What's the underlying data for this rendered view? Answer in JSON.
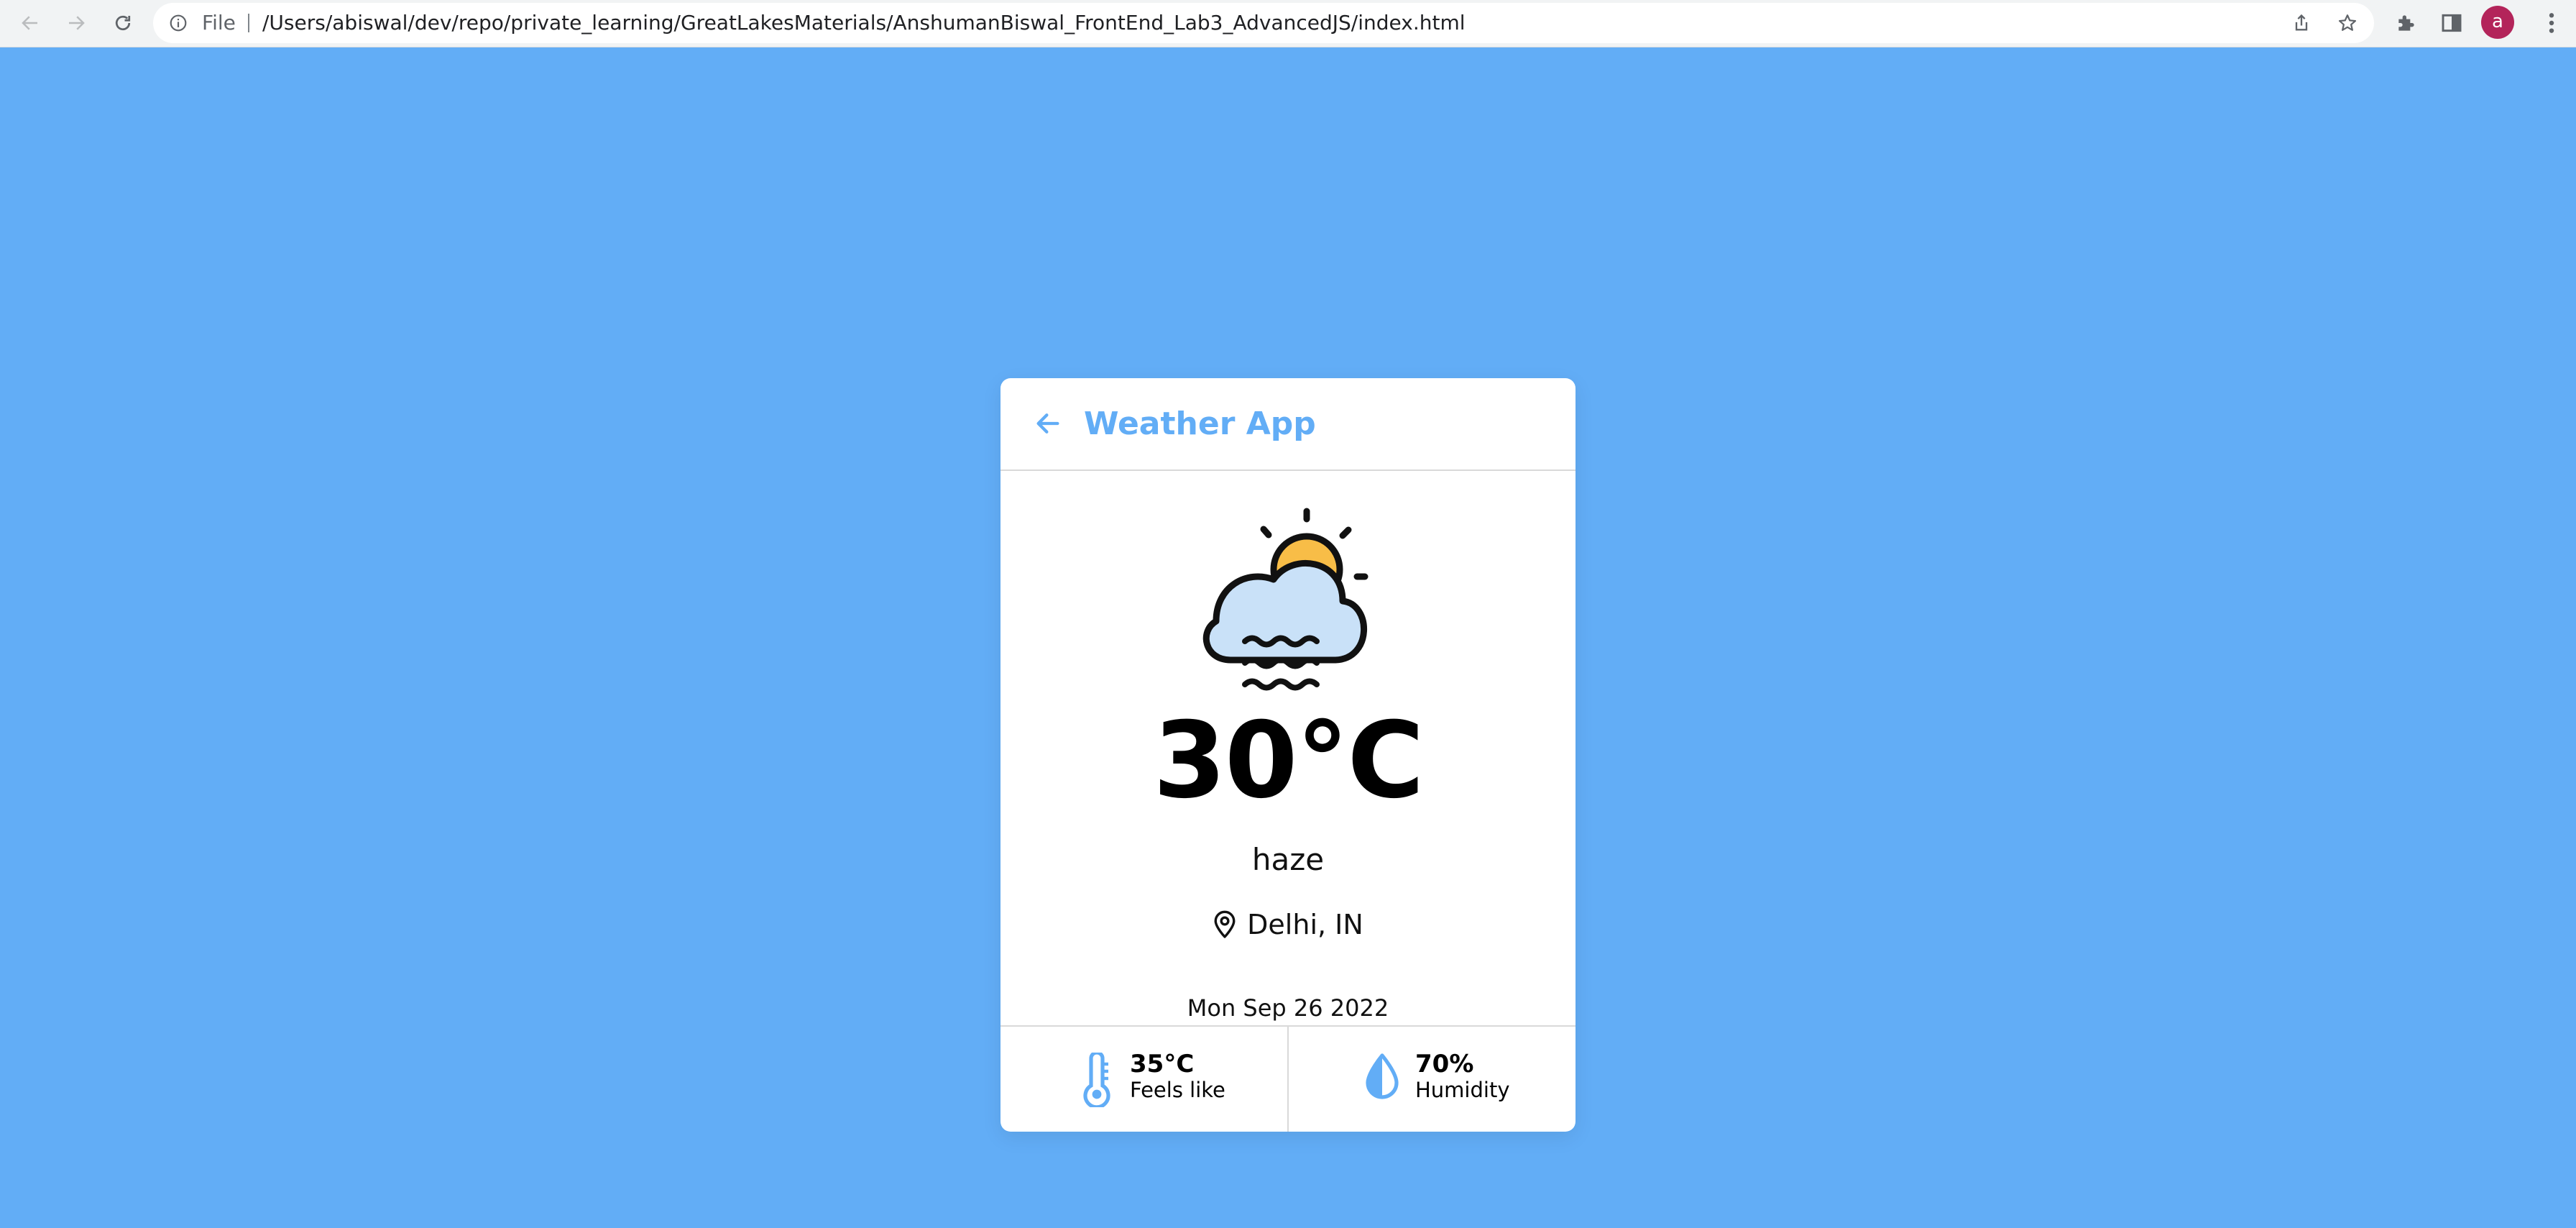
{
  "browser": {
    "scheme_label": "File",
    "url": "/Users/abiswal/dev/repo/private_learning/GreatLakesMaterials/AnshumanBiswal_FrontEnd_Lab3_AdvancedJS/index.html",
    "profile_initial": "a",
    "icons": [
      "back-arrow-icon",
      "forward-arrow-icon",
      "reload-icon",
      "info-icon",
      "share-icon",
      "star-icon",
      "puzzle-icon",
      "side-panel-icon",
      "kebab-menu-icon"
    ]
  },
  "colors": {
    "page_background": "#62adf6",
    "accent": "#62adf6",
    "sun": "#f8bd47",
    "cloud": "#c9e1f8",
    "avatar": "#b3245a"
  },
  "app": {
    "title": "Weather App",
    "temperature": "30°C",
    "condition": "haze",
    "location": "Delhi, IN",
    "date": "Mon Sep 26 2022",
    "feels_like": {
      "value": "35°C",
      "label": "Feels like"
    },
    "humidity": {
      "value": "70%",
      "label": "Humidity"
    }
  }
}
